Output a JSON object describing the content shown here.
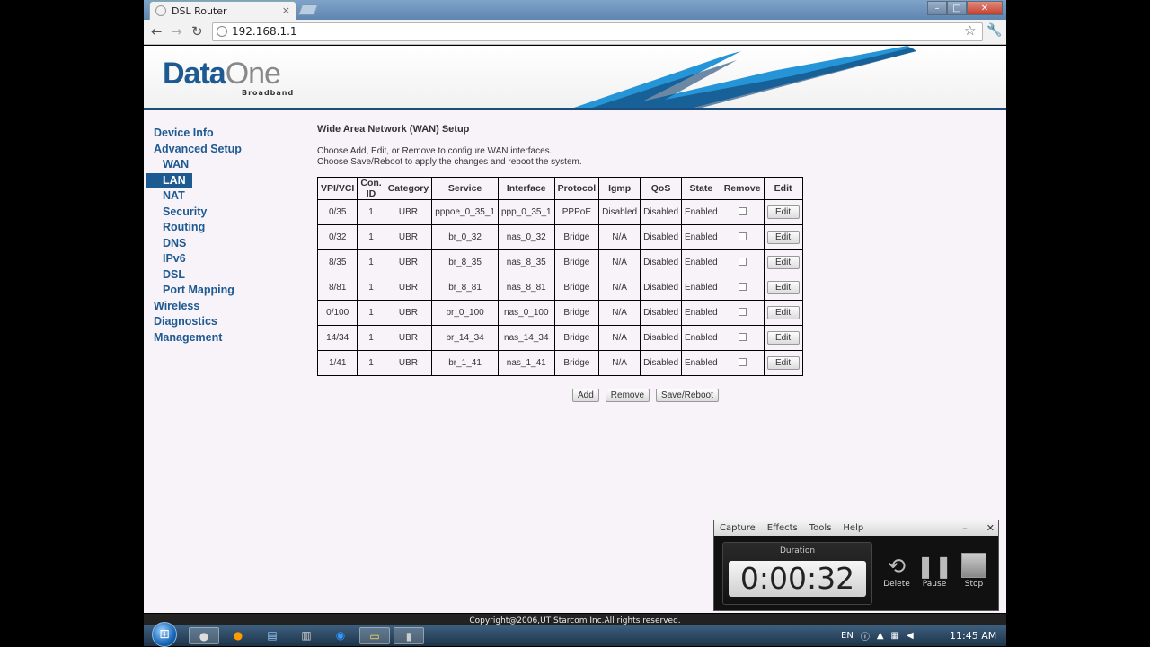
{
  "browser": {
    "tab_title": "DSL Router",
    "tab_close": "×",
    "url": "192.168.1.1",
    "back": "←",
    "forward": "→",
    "reload": "↻",
    "star": "☆",
    "wrench": "🔧",
    "win_min": "–",
    "win_max": "□",
    "win_close": "✕"
  },
  "header": {
    "logo_main": "Data",
    "logo_one": "One",
    "logo_sub": "Broadband"
  },
  "sidebar": {
    "items": [
      {
        "label": "Device Info"
      },
      {
        "label": "Advanced Setup"
      },
      {
        "label": "WAN"
      },
      {
        "label": "LAN"
      },
      {
        "label": "NAT"
      },
      {
        "label": "Security"
      },
      {
        "label": "Routing"
      },
      {
        "label": "DNS"
      },
      {
        "label": "IPv6"
      },
      {
        "label": "DSL"
      },
      {
        "label": "Port Mapping"
      },
      {
        "label": "Wireless"
      },
      {
        "label": "Diagnostics"
      },
      {
        "label": "Management"
      }
    ]
  },
  "main": {
    "title": "Wide Area Network (WAN) Setup",
    "desc_line1": "Choose Add, Edit, or Remove to configure WAN interfaces.",
    "desc_line2": "Choose Save/Reboot to apply the changes and reboot the system.",
    "columns": [
      "VPI/VCI",
      "Con. ID",
      "Category",
      "Service",
      "Interface",
      "Protocol",
      "Igmp",
      "QoS",
      "State",
      "Remove",
      "Edit"
    ],
    "edit_label": "Edit",
    "rows": [
      [
        "0/35",
        "1",
        "UBR",
        "pppoe_0_35_1",
        "ppp_0_35_1",
        "PPPoE",
        "Disabled",
        "Disabled",
        "Enabled"
      ],
      [
        "0/32",
        "1",
        "UBR",
        "br_0_32",
        "nas_0_32",
        "Bridge",
        "N/A",
        "Disabled",
        "Enabled"
      ],
      [
        "8/35",
        "1",
        "UBR",
        "br_8_35",
        "nas_8_35",
        "Bridge",
        "N/A",
        "Disabled",
        "Enabled"
      ],
      [
        "8/81",
        "1",
        "UBR",
        "br_8_81",
        "nas_8_81",
        "Bridge",
        "N/A",
        "Disabled",
        "Enabled"
      ],
      [
        "0/100",
        "1",
        "UBR",
        "br_0_100",
        "nas_0_100",
        "Bridge",
        "N/A",
        "Disabled",
        "Enabled"
      ],
      [
        "14/34",
        "1",
        "UBR",
        "br_14_34",
        "nas_14_34",
        "Bridge",
        "N/A",
        "Disabled",
        "Enabled"
      ],
      [
        "1/41",
        "1",
        "UBR",
        "br_1_41",
        "nas_1_41",
        "Bridge",
        "N/A",
        "Disabled",
        "Enabled"
      ]
    ],
    "add_label": "Add",
    "remove_label": "Remove",
    "save_label": "Save/Reboot"
  },
  "footer": {
    "copyright": "Copyright@2006,UT Starcom Inc.All rights reserved."
  },
  "recorder": {
    "menu": [
      "Capture",
      "Effects",
      "Tools",
      "Help"
    ],
    "min": "–",
    "close": "✕",
    "duration_label": "Duration",
    "time": "0:00:32",
    "delete_label": "Delete",
    "pause_label": "Pause",
    "stop_label": "Stop"
  },
  "taskbar": {
    "lang": "EN",
    "clock": "11:45 AM"
  },
  "colors": {
    "brand_blue": "#1e5a92",
    "page_bg": "#f8f3f8"
  }
}
